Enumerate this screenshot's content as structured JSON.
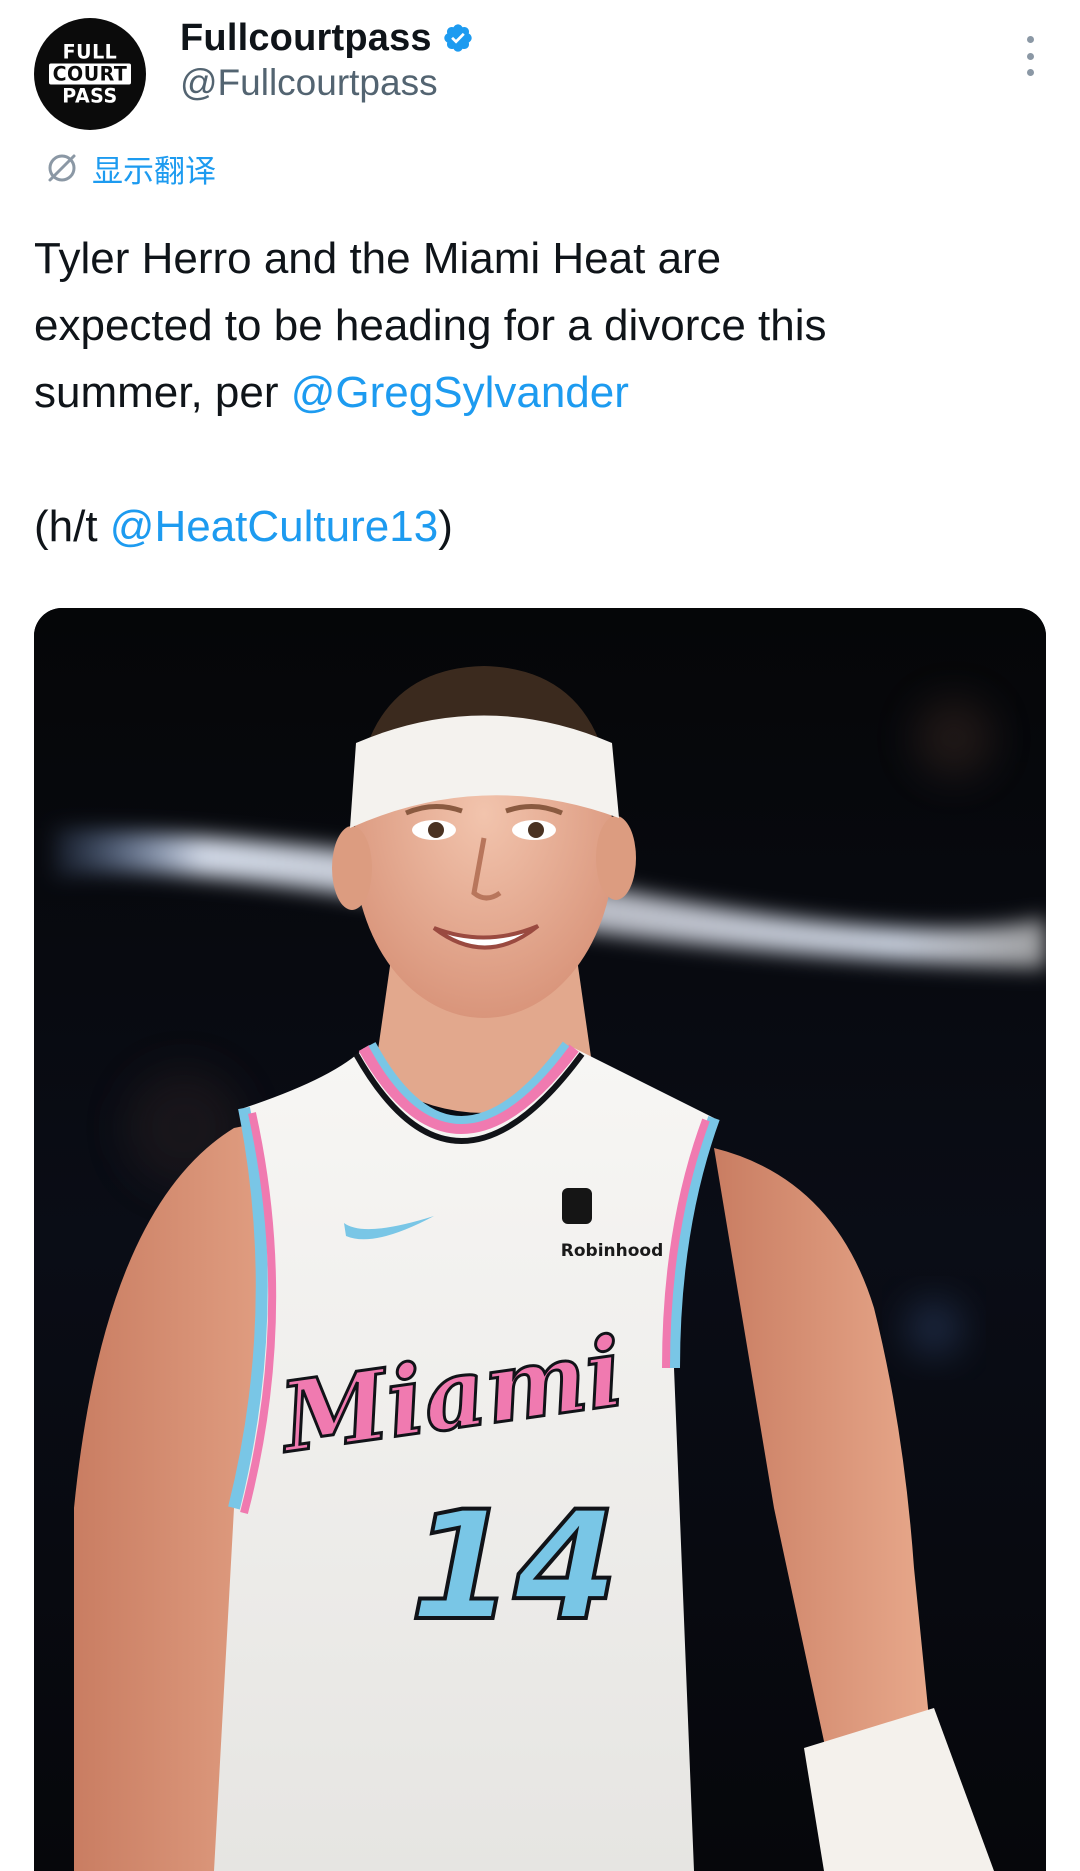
{
  "account": {
    "avatar_lines": [
      "FULL",
      "COURT",
      "PASS"
    ],
    "display_name": "Fullcourtpass",
    "handle": "@Fullcourtpass",
    "verified": true
  },
  "icons": {
    "verified": "verified-badge-icon",
    "more": "more-options-icon",
    "translate": "translate-icon"
  },
  "translate_label": "显示翻译",
  "tweet": {
    "line1": "Tyler Herro and the Miami Heat are",
    "line2": "expected to be heading for a divorce this",
    "line3_prefix": "summer, per ",
    "mention1": "@GregSylvander",
    "line5_prefix": "(h/t ",
    "mention2": "@HeatCulture13",
    "line5_suffix": ")"
  },
  "media": {
    "jersey_wordmark": "Miami",
    "jersey_number": "14",
    "sponsor": "Robinhood"
  },
  "colors": {
    "text": "#0f1419",
    "secondary": "#536471",
    "accent": "#1d9bf0",
    "jersey_pink": "#f07ab0",
    "jersey_blue": "#79c6e6"
  }
}
